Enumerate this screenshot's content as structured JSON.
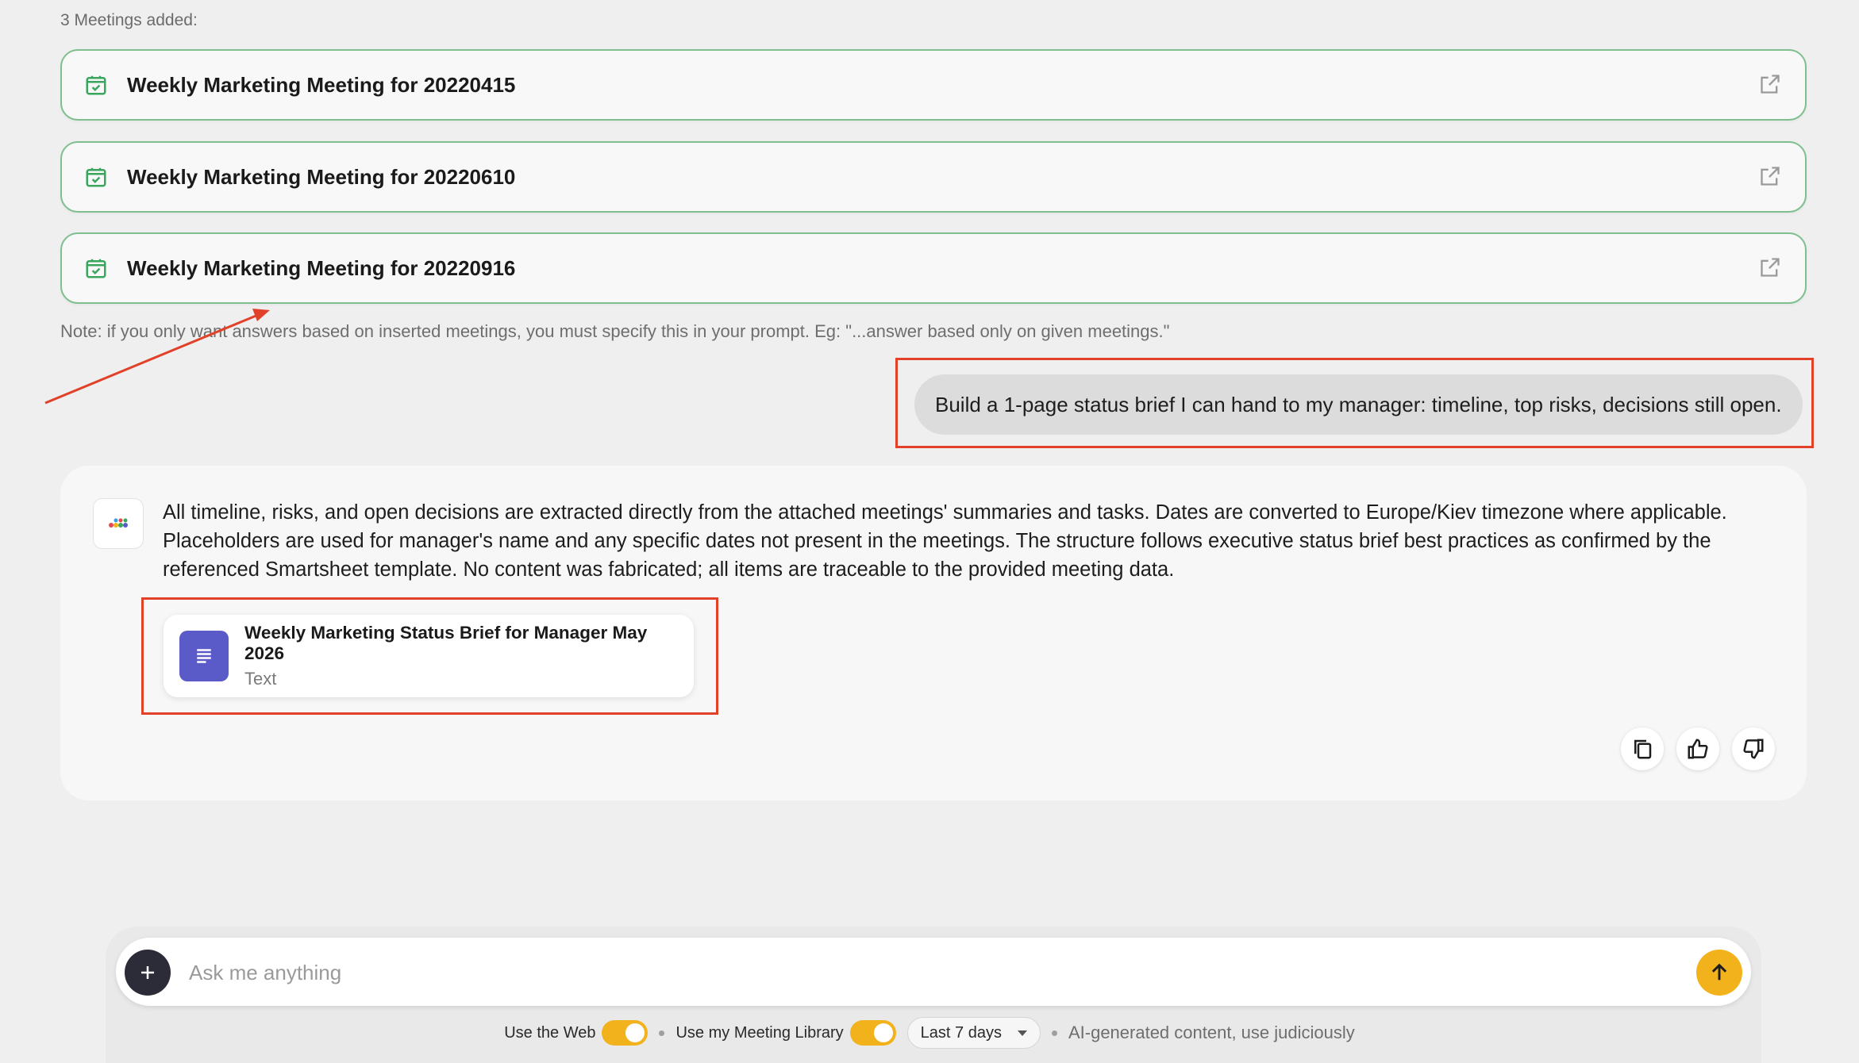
{
  "meetings": {
    "added_label": "3 Meetings added:",
    "items": [
      {
        "title": "Weekly Marketing Meeting for 20220415"
      },
      {
        "title": "Weekly Marketing Meeting for 20220610"
      },
      {
        "title": "Weekly Marketing Meeting for 20220916"
      }
    ],
    "note": "Note: if you only want answers based on inserted meetings, you must specify this in your prompt. Eg: \"...answer based only on given meetings.\""
  },
  "chat": {
    "user_message": "Build a 1-page status brief I can hand to my manager: timeline, top risks, decisions still open.",
    "assistant_message": "All timeline, risks, and open decisions are extracted directly from the attached meetings' summaries and tasks. Dates are converted to Europe/Kiev timezone where applicable. Placeholders are used for manager's name and any specific dates not present in the meetings. The structure follows executive status brief best practices as confirmed by the referenced Smartsheet template. No content was fabricated; all items are traceable to the provided meeting data.",
    "attachment": {
      "title": "Weekly Marketing Status Brief for Manager May 2026",
      "type": "Text"
    }
  },
  "composer": {
    "placeholder": "Ask me anything",
    "use_web_label": "Use the Web",
    "use_web_enabled": true,
    "use_library_label": "Use my Meeting Library",
    "use_library_enabled": true,
    "range_value": "Last 7 days",
    "disclaimer": "AI-generated content, use judiciously"
  },
  "colors": {
    "accent": "#f2b21b",
    "meeting_border": "#7fbf8f",
    "calendar_icon": "#3aa55d",
    "annotation": "#e04128",
    "doc_icon_bg": "#5a5bc8"
  }
}
